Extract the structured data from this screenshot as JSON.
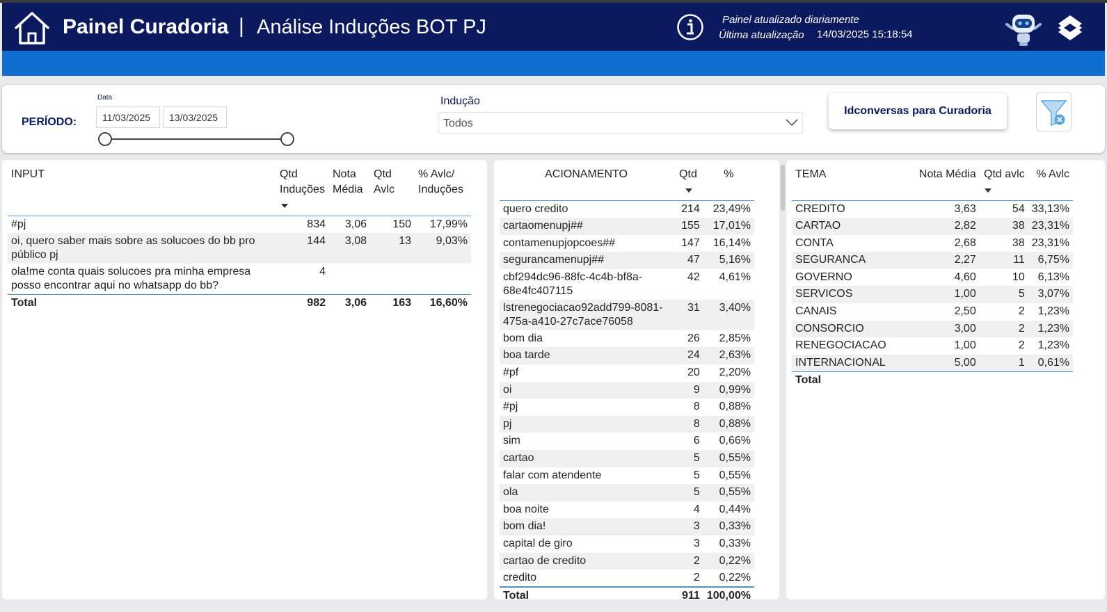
{
  "header": {
    "title_main": "Painel Curadoria",
    "title_separator": "|",
    "title_sub": "Análise Induções BOT PJ",
    "update_line1": "Painel atualizado diariamente",
    "update_line2": "Última atualização",
    "update_datetime": "14/03/2025 15:18:54"
  },
  "filters": {
    "periodo_label": "PERÍODO:",
    "data_label": "Data",
    "date_start": "11/03/2025",
    "date_end": "13/03/2025",
    "inducao_label": "Indução",
    "inducao_value": "Todos",
    "idconversas_button": "Idconversas para Curadoria"
  },
  "input_table": {
    "headers": {
      "input": "INPUT",
      "qtd_inducoes": "Qtd Induções",
      "nota_media": "Nota Média",
      "qtd_avlc": "Qtd Avlc",
      "pct": "% Avlc/ Induções"
    },
    "rows": [
      {
        "input": "#pj",
        "qtd": "834",
        "nota": "3,06",
        "avlc": "150",
        "pct": "17,99%"
      },
      {
        "input": "oi, quero saber mais sobre as solucoes do bb pro público pj",
        "qtd": "144",
        "nota": "3,08",
        "avlc": "13",
        "pct": "9,03%"
      },
      {
        "input": "ola!me conta quais solucoes pra minha empresa posso encontrar aqui no whatsapp do bb?",
        "qtd": "4",
        "nota": "",
        "avlc": "",
        "pct": ""
      }
    ],
    "total": {
      "label": "Total",
      "qtd": "982",
      "nota": "3,06",
      "avlc": "163",
      "pct": "16,60%"
    }
  },
  "acionamento_table": {
    "headers": {
      "acionamento": "ACIONAMENTO",
      "qtd": "Qtd",
      "pct": "%"
    },
    "rows": [
      {
        "label": "quero credito",
        "qtd": "214",
        "pct": "23,49%"
      },
      {
        "label": "cartaomenupj##",
        "qtd": "155",
        "pct": "17,01%"
      },
      {
        "label": "contamenupjopcoes##",
        "qtd": "147",
        "pct": "16,14%"
      },
      {
        "label": "segurancamenupj##",
        "qtd": "47",
        "pct": "5,16%"
      },
      {
        "label": "cbf294dc96-88fc-4c4b-bf8a-68e4fc407115",
        "qtd": "42",
        "pct": "4,61%"
      },
      {
        "label": "lstrenegociacao92add799-8081-475a-a410-27c7ace76058",
        "qtd": "31",
        "pct": "3,40%"
      },
      {
        "label": "bom dia",
        "qtd": "26",
        "pct": "2,85%"
      },
      {
        "label": "boa tarde",
        "qtd": "24",
        "pct": "2,63%"
      },
      {
        "label": "#pf",
        "qtd": "20",
        "pct": "2,20%"
      },
      {
        "label": "oi",
        "qtd": "9",
        "pct": "0,99%"
      },
      {
        "label": "#pj",
        "qtd": "8",
        "pct": "0,88%"
      },
      {
        "label": "pj",
        "qtd": "8",
        "pct": "0,88%"
      },
      {
        "label": "sim",
        "qtd": "6",
        "pct": "0,66%"
      },
      {
        "label": "cartao",
        "qtd": "5",
        "pct": "0,55%"
      },
      {
        "label": "falar com atendente",
        "qtd": "5",
        "pct": "0,55%"
      },
      {
        "label": "ola",
        "qtd": "5",
        "pct": "0,55%"
      },
      {
        "label": "boa noite",
        "qtd": "4",
        "pct": "0,44%"
      },
      {
        "label": "bom dia!",
        "qtd": "3",
        "pct": "0,33%"
      },
      {
        "label": "capital de giro",
        "qtd": "3",
        "pct": "0,33%"
      },
      {
        "label": "cartao de credito",
        "qtd": "2",
        "pct": "0,22%"
      },
      {
        "label": "credito",
        "qtd": "2",
        "pct": "0,22%"
      }
    ],
    "total": {
      "label": "Total",
      "qtd": "911",
      "pct": "100,00%"
    }
  },
  "tema_table": {
    "headers": {
      "tema": "TEMA",
      "nota_media": "Nota Média",
      "qtd_avlc": "Qtd avlc",
      "pct_avlc": "% Avlc"
    },
    "rows": [
      {
        "tema": "CREDITO",
        "nota": "3,63",
        "qtd": "54",
        "pct": "33,13%"
      },
      {
        "tema": "CARTAO",
        "nota": "2,82",
        "qtd": "38",
        "pct": "23,31%"
      },
      {
        "tema": "CONTA",
        "nota": "2,68",
        "qtd": "38",
        "pct": "23,31%"
      },
      {
        "tema": "SEGURANCA",
        "nota": "2,27",
        "qtd": "11",
        "pct": "6,75%"
      },
      {
        "tema": "GOVERNO",
        "nota": "4,60",
        "qtd": "10",
        "pct": "6,13%"
      },
      {
        "tema": "SERVICOS",
        "nota": "1,00",
        "qtd": "5",
        "pct": "3,07%"
      },
      {
        "tema": "CANAIS",
        "nota": "2,50",
        "qtd": "2",
        "pct": "1,23%"
      },
      {
        "tema": "CONSORCIO",
        "nota": "3,00",
        "qtd": "2",
        "pct": "1,23%"
      },
      {
        "tema": "RENEGOCIACAO",
        "nota": "1,00",
        "qtd": "2",
        "pct": "1,23%"
      },
      {
        "tema": "INTERNACIONAL",
        "nota": "5,00",
        "qtd": "1",
        "pct": "0,61%"
      }
    ],
    "total": {
      "label": "Total"
    }
  },
  "colors": {
    "header_bg": "#0b1a5e",
    "band_blue": "#0e6fcf",
    "accent_line": "#4a90d9"
  }
}
